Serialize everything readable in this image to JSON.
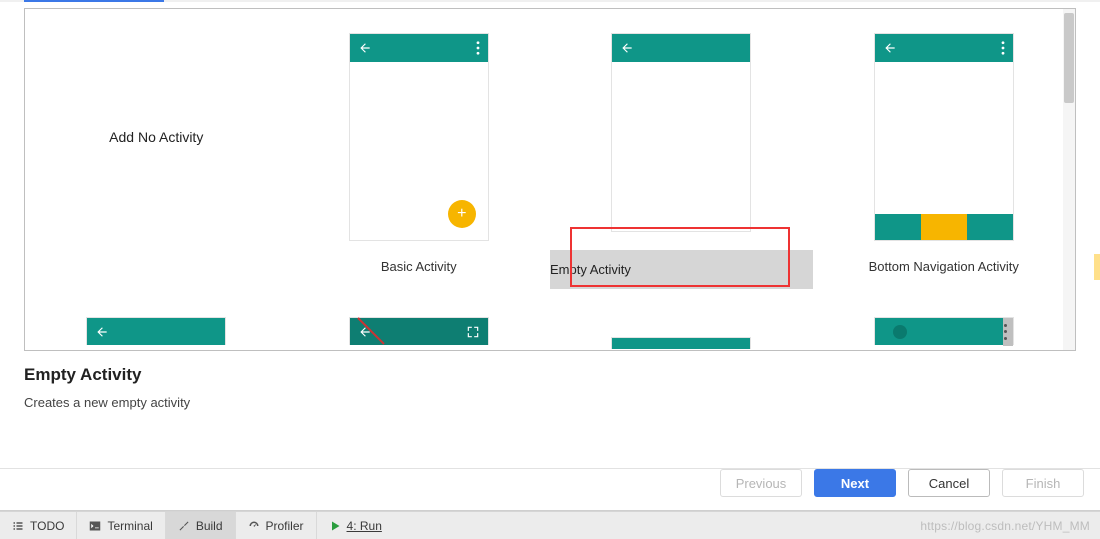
{
  "templates": {
    "row1": [
      {
        "name": "Add No Activity"
      },
      {
        "name": "Basic Activity"
      },
      {
        "name": "Empty Activity",
        "selected": true
      },
      {
        "name": "Bottom Navigation Activity"
      }
    ]
  },
  "selection": {
    "title": "Empty Activity",
    "description": "Creates a new empty activity"
  },
  "buttons": {
    "previous": "Previous",
    "next": "Next",
    "cancel": "Cancel",
    "finish": "Finish"
  },
  "statusbar": {
    "todo": "TODO",
    "terminal": "Terminal",
    "build": "Build",
    "profiler": "Profiler",
    "run": "4: Run"
  },
  "watermark": "https://blog.csdn.net/YHM_MM",
  "colors": {
    "teal": "#0f9688",
    "accent": "#f7b500",
    "primary_btn": "#3b78e7",
    "highlight_red": "#e33"
  }
}
